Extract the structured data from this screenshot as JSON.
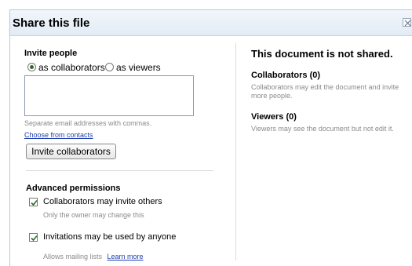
{
  "dialog": {
    "title": "Share this file",
    "close_icon": "close-x-icon"
  },
  "invite": {
    "section_label": "Invite people",
    "radio_collaborators": "as collaborators",
    "radio_viewers": "as viewers",
    "selected": "as collaborators",
    "email_value": "",
    "hint": "Separate email addresses with commas.",
    "choose_contacts": "Choose from contacts",
    "invite_button": "Invite collaborators"
  },
  "advanced": {
    "section_label": "Advanced permissions",
    "options": [
      {
        "label": "Collaborators may invite others",
        "checked": true,
        "note": "Only the owner may change this"
      },
      {
        "label": "Invitations may be used by anyone",
        "checked": true,
        "note": "Allows mailing lists"
      }
    ],
    "learn_more": "Learn more"
  },
  "status": {
    "heading": "This document is not shared.",
    "collaborators_title": "Collaborators (0)",
    "collaborators_desc": "Collaborators may edit the document and invite more people.",
    "viewers_title": "Viewers (0)",
    "viewers_desc": "Viewers may see the document but not edit it."
  },
  "colors": {
    "link": "#1f3fb0",
    "check": "#2a6c2a",
    "hint": "#8b8b8b"
  }
}
